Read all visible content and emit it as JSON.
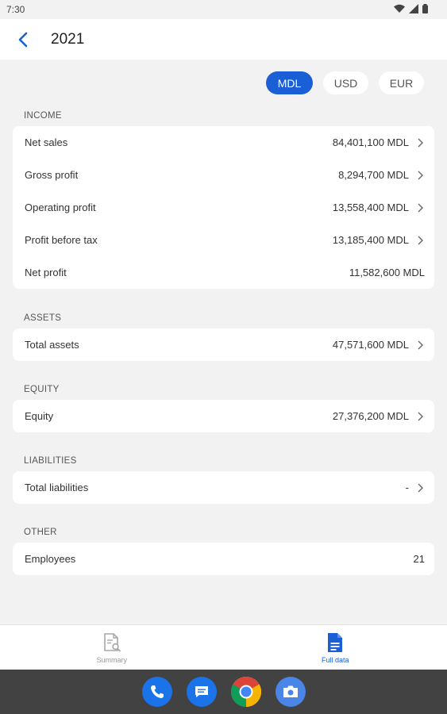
{
  "status": {
    "time": "7:30"
  },
  "header": {
    "title": "2021"
  },
  "currencies": [
    {
      "label": "MDL",
      "active": true
    },
    {
      "label": "USD",
      "active": false
    },
    {
      "label": "EUR",
      "active": false
    }
  ],
  "sections": {
    "income": {
      "label": "INCOME",
      "rows": [
        {
          "label": "Net sales",
          "value": "84,401,100 MDL"
        },
        {
          "label": "Gross profit",
          "value": "8,294,700 MDL"
        },
        {
          "label": "Operating profit",
          "value": "13,558,400 MDL"
        },
        {
          "label": "Profit before tax",
          "value": "13,185,400 MDL"
        },
        {
          "label": "Net profit",
          "value": "11,582,600 MDL"
        }
      ]
    },
    "assets": {
      "label": "ASSETS",
      "rows": [
        {
          "label": "Total assets",
          "value": "47,571,600 MDL"
        }
      ]
    },
    "equity": {
      "label": "EQUITY",
      "rows": [
        {
          "label": "Equity",
          "value": "27,376,200 MDL"
        }
      ]
    },
    "liabilities": {
      "label": "LIABILITIES",
      "rows": [
        {
          "label": "Total liabilities",
          "value": "-"
        }
      ]
    },
    "other": {
      "label": "OTHER",
      "rows": [
        {
          "label": "Employees",
          "value": "21"
        }
      ]
    }
  },
  "bottom_nav": {
    "summary_label": "Summary",
    "full_data_label": "Full data"
  },
  "icons": {
    "back": "chevron-left-icon",
    "chevron": "chevron-right-icon",
    "summary": "document-search-icon",
    "full_data": "document-icon"
  },
  "colors": {
    "accent": "#1a5fd6",
    "background": "#f2f2f2",
    "card": "#ffffff"
  }
}
